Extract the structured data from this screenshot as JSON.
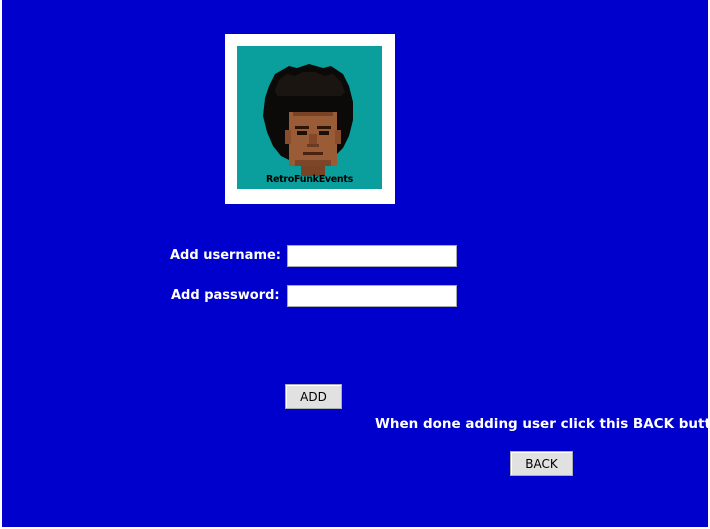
{
  "logo": {
    "caption": "RetroFunkEvents",
    "background_color": "#0a9f9c"
  },
  "form": {
    "username_label": "Add username:",
    "username_value": "",
    "password_label": "Add password:",
    "password_value": ""
  },
  "buttons": {
    "add_label": "ADD",
    "back_label": "BACK"
  },
  "instruction_text": "When done adding user click this BACK button",
  "colors": {
    "page_background": "#0000cc",
    "label_text": "#ffffff",
    "button_face": "#e1e1e1"
  }
}
